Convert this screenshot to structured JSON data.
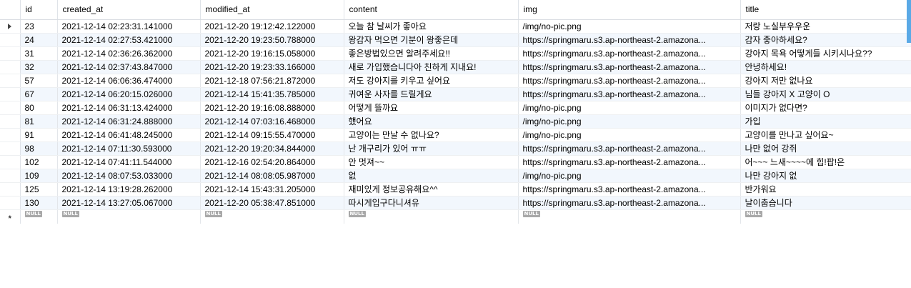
{
  "columns": [
    "id",
    "created_at",
    "modified_at",
    "content",
    "img",
    "title"
  ],
  "rows": [
    {
      "id": "23",
      "created_at": "2021-12-14 02:23:31.141000",
      "modified_at": "2021-12-20 19:12:42.122000",
      "content": "오늘 참 날씨가 좋아요",
      "img": "/img/no-pic.png",
      "title": "저랑 노실부우우운"
    },
    {
      "id": "24",
      "created_at": "2021-12-14 02:27:53.421000",
      "modified_at": "2021-12-20 19:23:50.788000",
      "content": "왕감자 먹으면 기분이 왕좋은데",
      "img": "https://springmaru.s3.ap-northeast-2.amazona...",
      "title": "감자 좋아하세요?"
    },
    {
      "id": "31",
      "created_at": "2021-12-14 02:36:26.362000",
      "modified_at": "2021-12-20 19:16:15.058000",
      "content": "좋은방법있으면 알려주세요!!",
      "img": "https://springmaru.s3.ap-northeast-2.amazona...",
      "title": "강아지 목욕 어떻게들 시키시나요??"
    },
    {
      "id": "32",
      "created_at": "2021-12-14 02:37:43.847000",
      "modified_at": "2021-12-20 19:23:33.166000",
      "content": "새로 가입했습니다아 친하게 지내요!",
      "img": "https://springmaru.s3.ap-northeast-2.amazona...",
      "title": "안녕하세요!"
    },
    {
      "id": "57",
      "created_at": "2021-12-14 06:06:36.474000",
      "modified_at": "2021-12-18 07:56:21.872000",
      "content": "저도 강아지를 키우고 싶어요",
      "img": "https://springmaru.s3.ap-northeast-2.amazona...",
      "title": "강아지 저만 없나요"
    },
    {
      "id": "67",
      "created_at": "2021-12-14 06:20:15.026000",
      "modified_at": "2021-12-14 15:41:35.785000",
      "content": "귀여운 사자를 드릴게요",
      "img": "https://springmaru.s3.ap-northeast-2.amazona...",
      "title": "님들 강아지 X 고양이 O"
    },
    {
      "id": "80",
      "created_at": "2021-12-14 06:31:13.424000",
      "modified_at": "2021-12-20 19:16:08.888000",
      "content": "어떻게 뜰까요",
      "img": "/img/no-pic.png",
      "title": "이미지가 없다면?"
    },
    {
      "id": "81",
      "created_at": "2021-12-14 06:31:24.888000",
      "modified_at": "2021-12-14 07:03:16.468000",
      "content": "했어요",
      "img": "/img/no-pic.png",
      "title": "가입"
    },
    {
      "id": "91",
      "created_at": "2021-12-14 06:41:48.245000",
      "modified_at": "2021-12-14 09:15:55.470000",
      "content": "고양이는 만날 수 없나요?",
      "img": "/img/no-pic.png",
      "title": "고양이를 만나고 싶어요~"
    },
    {
      "id": "98",
      "created_at": "2021-12-14 07:11:30.593000",
      "modified_at": "2021-12-20 19:20:34.844000",
      "content": "난 개구리가 있어 ㅠㅠ",
      "img": "https://springmaru.s3.ap-northeast-2.amazona...",
      "title": "나만 없어 강쥐"
    },
    {
      "id": "102",
      "created_at": "2021-12-14 07:41:11.544000",
      "modified_at": "2021-12-16 02:54:20.864000",
      "content": "안 멋져~~",
      "img": "https://springmaru.s3.ap-northeast-2.amazona...",
      "title": "어~~~ 느새~~~~에 힙!팝!은"
    },
    {
      "id": "109",
      "created_at": "2021-12-14 08:07:53.033000",
      "modified_at": "2021-12-14 08:08:05.987000",
      "content": "없",
      "img": "/img/no-pic.png",
      "title": "나만 강아지 없"
    },
    {
      "id": "125",
      "created_at": "2021-12-14 13:19:28.262000",
      "modified_at": "2021-12-14 15:43:31.205000",
      "content": "재미있게 정보공유해요^^",
      "img": "https://springmaru.s3.ap-northeast-2.amazona...",
      "title": "반가워요"
    },
    {
      "id": "130",
      "created_at": "2021-12-14 13:27:05.067000",
      "modified_at": "2021-12-20 05:38:47.851000",
      "content": "따시게입구다니셔유",
      "img": "https://springmaru.s3.ap-northeast-2.amazona...",
      "title": "날이춥습니다"
    }
  ],
  "new_row": {
    "marker": "*",
    "null_label": "NULL"
  },
  "current_row_indicator": "row-pointer-icon",
  "colors": {
    "alt_row": "#f2f7fd",
    "null_badge": "#a8a8a8",
    "scrollbar": "#5aa9e6"
  }
}
